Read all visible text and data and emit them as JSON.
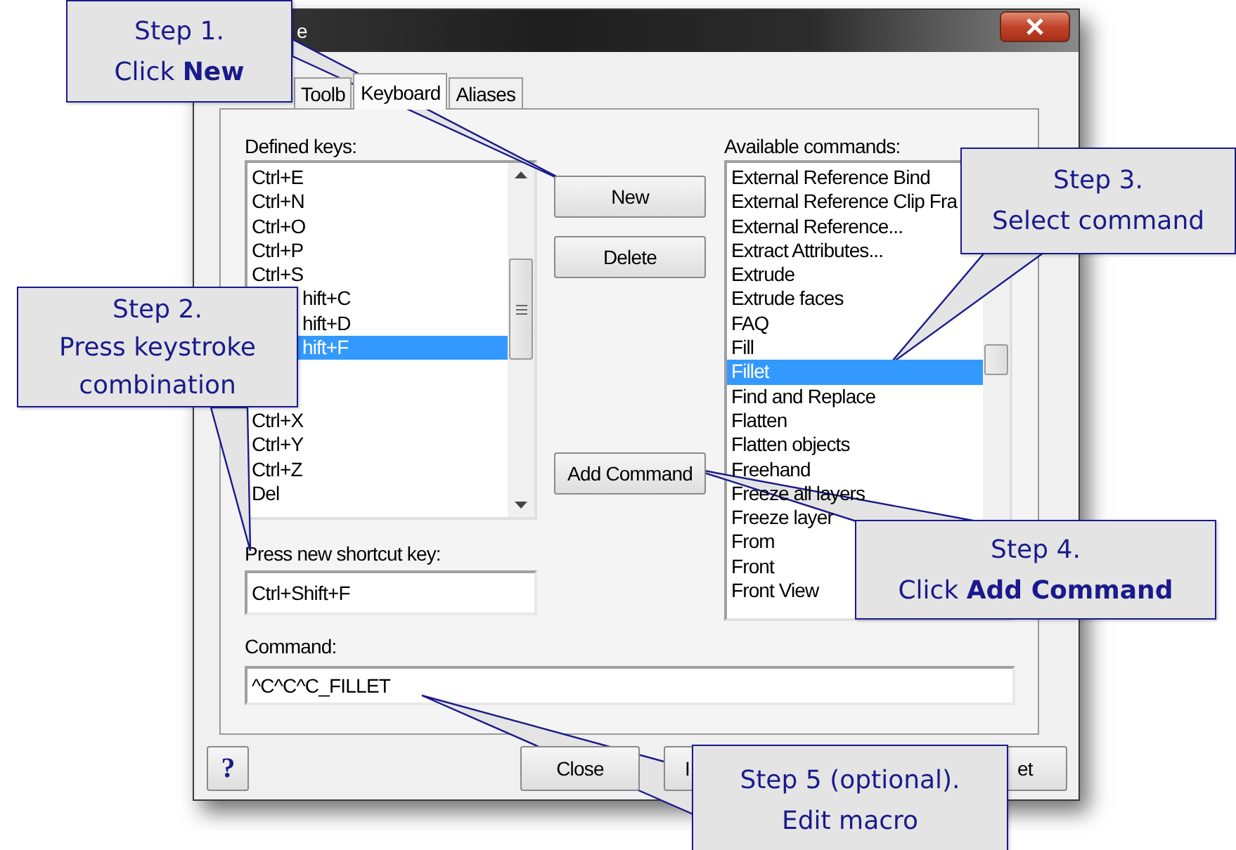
{
  "window": {
    "title": "e"
  },
  "tabs": [
    {
      "label": "Toolb",
      "selected": false
    },
    {
      "label": "Keyboard",
      "selected": true
    },
    {
      "label": "Aliases",
      "selected": false
    }
  ],
  "defined_keys": {
    "label": "Defined keys:",
    "items": [
      {
        "text": "Ctrl+E",
        "selected": false,
        "kind": "plain"
      },
      {
        "text": "Ctrl+N",
        "selected": false,
        "kind": "plain"
      },
      {
        "text": "Ctrl+O",
        "selected": false,
        "kind": "plain"
      },
      {
        "text": "Ctrl+P",
        "selected": false,
        "kind": "plain"
      },
      {
        "text": "Ctrl+S",
        "selected": false,
        "kind": "plain"
      },
      {
        "text": "hift+C",
        "selected": false,
        "kind": "covered"
      },
      {
        "text": "hift+D",
        "selected": false,
        "kind": "covered"
      },
      {
        "text": "hift+F",
        "selected": true,
        "kind": "covered"
      },
      {
        "kind": "hidden"
      },
      {
        "kind": "hidden"
      },
      {
        "text": "Ctrl+X",
        "selected": false,
        "kind": "plain"
      },
      {
        "text": "Ctrl+Y",
        "selected": false,
        "kind": "plain"
      },
      {
        "text": "Ctrl+Z",
        "selected": false,
        "kind": "plain"
      },
      {
        "text": "Del",
        "selected": false,
        "kind": "plain"
      }
    ]
  },
  "middle_buttons": [
    {
      "label": "New"
    },
    {
      "label": "Delete"
    },
    {
      "label": "Add Command"
    }
  ],
  "available_commands": {
    "label": "Available commands:",
    "items": [
      {
        "text": "External Reference Bind",
        "selected": false
      },
      {
        "text": "External Reference Clip Fra",
        "selected": false
      },
      {
        "text": "External Reference...",
        "selected": false
      },
      {
        "text": "Extract Attributes...",
        "selected": false
      },
      {
        "text": "Extrude",
        "selected": false
      },
      {
        "text": "Extrude faces",
        "selected": false
      },
      {
        "text": "FAQ",
        "selected": false
      },
      {
        "text": "Fill",
        "selected": false
      },
      {
        "text": "Fillet",
        "selected": true
      },
      {
        "text": "Find and Replace",
        "selected": false
      },
      {
        "text": "Flatten",
        "selected": false
      },
      {
        "text": "Flatten objects",
        "selected": false
      },
      {
        "text": "Freehand",
        "selected": false
      },
      {
        "text": "Freeze all layers",
        "selected": false
      },
      {
        "text": "Freeze layer",
        "selected": false
      },
      {
        "text": "From",
        "selected": false
      },
      {
        "text": "Front",
        "selected": false
      },
      {
        "text": "Front View",
        "selected": false
      }
    ]
  },
  "shortcut": {
    "label": "Press new shortcut key:",
    "value": "Ctrl+Shift+F"
  },
  "command": {
    "label": "Command:",
    "value": "^C^C^C_FILLET"
  },
  "footer_buttons": [
    {
      "label": "?",
      "kind": "help"
    },
    {
      "label": "Close",
      "kind": "normal"
    },
    {
      "label": "I",
      "kind": "covered"
    },
    {
      "label": "et",
      "kind": "end"
    }
  ],
  "callouts": [
    {
      "lines": [
        "Step 1.",
        "Click **New**"
      ]
    },
    {
      "lines": [
        "Step 2.",
        "Press keystroke",
        "combination"
      ]
    },
    {
      "lines": [
        "Step 3.",
        "Select command"
      ]
    },
    {
      "lines": [
        "Step 4.",
        "Click **Add Command**"
      ]
    },
    {
      "lines": [
        "Step 5 (optional).",
        "Edit macro"
      ]
    }
  ]
}
